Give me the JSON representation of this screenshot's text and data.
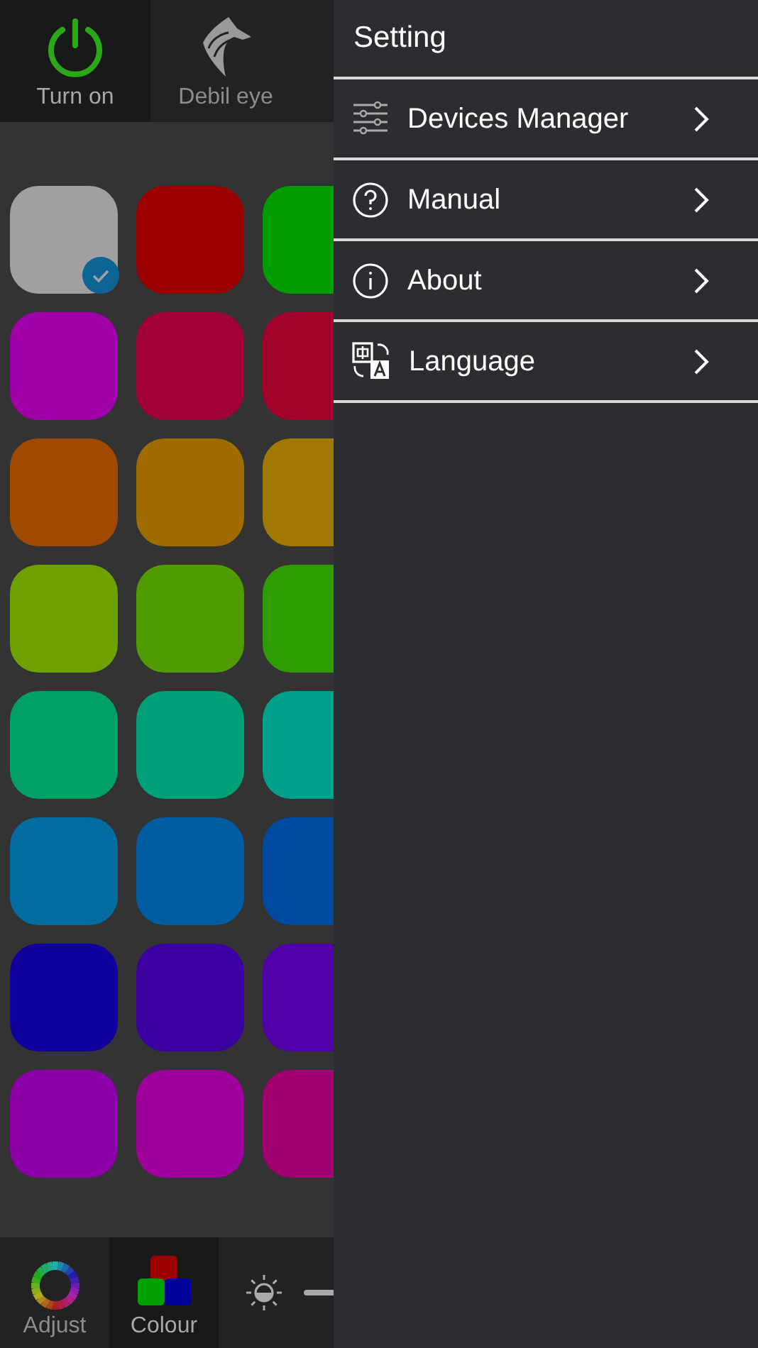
{
  "top_tabs": [
    {
      "label": "Turn on",
      "kind": "power",
      "selected": true
    },
    {
      "label": "Debil eye",
      "kind": "wolf",
      "selected": false
    }
  ],
  "swatches": [
    {
      "color": "#a0a0a0",
      "selected": true
    },
    {
      "color": "#9c0000",
      "selected": false
    },
    {
      "color": "#009c00"
    },
    {
      "color": "#a000a8",
      "selected": false
    },
    {
      "color": "#a00038",
      "selected": false
    },
    {
      "color": "#a0002a"
    },
    {
      "color": "#a04a00",
      "selected": false
    },
    {
      "color": "#a06c00",
      "selected": false
    },
    {
      "color": "#a07800"
    },
    {
      "color": "#6ea000",
      "selected": false
    },
    {
      "color": "#509c00",
      "selected": false
    },
    {
      "color": "#2e9c00"
    },
    {
      "color": "#00a064",
      "selected": false
    },
    {
      "color": "#00a07a",
      "selected": false
    },
    {
      "color": "#00a08a"
    },
    {
      "color": "#006ca0",
      "selected": false
    },
    {
      "color": "#005ca0",
      "selected": false
    },
    {
      "color": "#004aa0"
    },
    {
      "color": "#10009c",
      "selected": false
    },
    {
      "color": "#3c00a0",
      "selected": false
    },
    {
      "color": "#5200a8"
    },
    {
      "color": "#8c00a8",
      "selected": false
    },
    {
      "color": "#a0009c",
      "selected": false
    },
    {
      "color": "#a00070"
    }
  ],
  "bottom_tabs": [
    {
      "label": "Adjust",
      "kind": "wheel",
      "selected": false
    },
    {
      "label": "Colour",
      "kind": "blocks",
      "selected": true
    }
  ],
  "drawer": {
    "title": "Setting",
    "items": [
      {
        "label": "Devices Manager",
        "kind": "sliders"
      },
      {
        "label": "Manual",
        "kind": "help"
      },
      {
        "label": "About",
        "kind": "info"
      },
      {
        "label": "Language",
        "kind": "translate"
      }
    ]
  }
}
